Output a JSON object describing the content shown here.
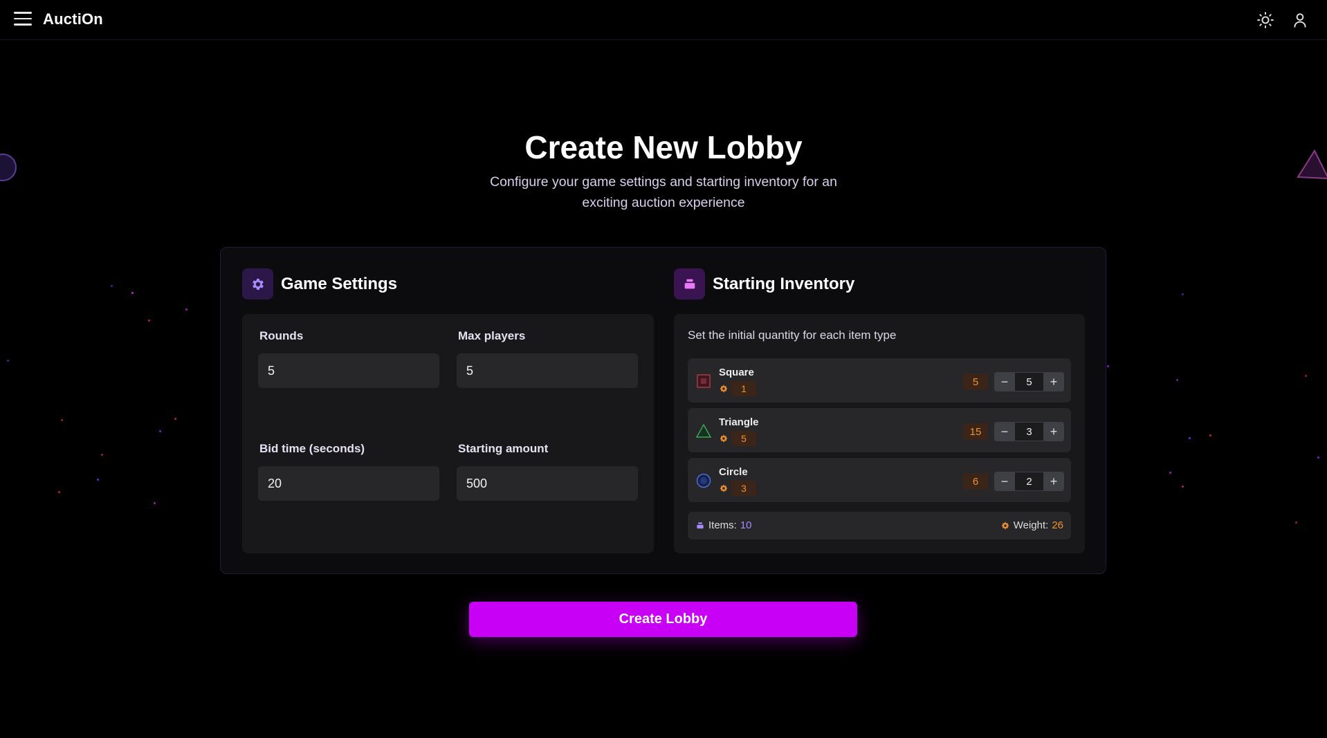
{
  "header": {
    "brand": "AuctiOn"
  },
  "page": {
    "title": "Create New Lobby",
    "subtitle": "Configure your game settings and starting inventory for an exciting auction experience"
  },
  "game_settings": {
    "title": "Game Settings",
    "fields": {
      "rounds": {
        "label": "Rounds",
        "value": "5"
      },
      "max_players": {
        "label": "Max players",
        "value": "5"
      },
      "bid_time": {
        "label": "Bid time (seconds)",
        "value": "20"
      },
      "starting_amount": {
        "label": "Starting amount",
        "value": "500"
      }
    }
  },
  "inventory": {
    "title": "Starting Inventory",
    "caption": "Set the initial quantity for each item type",
    "items": [
      {
        "name": "Square",
        "weight": "1",
        "total_weight": "5",
        "quantity": "5"
      },
      {
        "name": "Triangle",
        "weight": "5",
        "total_weight": "15",
        "quantity": "3"
      },
      {
        "name": "Circle",
        "weight": "3",
        "total_weight": "6",
        "quantity": "2"
      }
    ],
    "summary": {
      "items_label": "Items:",
      "items_value": "10",
      "weight_label": "Weight:",
      "weight_value": "26"
    }
  },
  "actions": {
    "create_label": "Create Lobby"
  },
  "colors": {
    "accent": "#c800f5",
    "purple_text": "#a78bfa",
    "orange_text": "#f0922e",
    "background": "#000000",
    "card": "#0c0c0e",
    "panel": "#18181b"
  },
  "icons": {
    "menu": "hamburger-menu-icon",
    "theme": "sun-icon",
    "user": "user-icon",
    "settings": "gear-icon",
    "inventory": "stack-icon",
    "weight": "weight-icon"
  }
}
